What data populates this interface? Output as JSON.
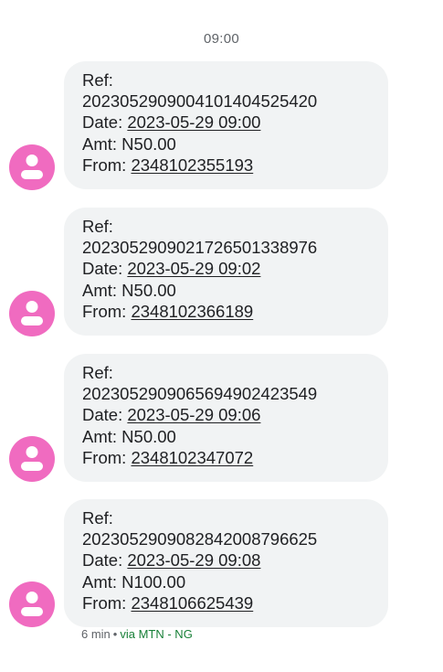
{
  "conversation": {
    "timestamp": "09:00",
    "messages": [
      {
        "ref_label": "Ref:",
        "ref": "20230529090041014045254 20",
        "date_label": "Date:",
        "date": "2023-05-29 09:00",
        "amt_label": "Amt:",
        "amt": "N50.00",
        "from_label": "From:",
        "from": "2348102355193"
      },
      {
        "ref_label": "Ref:",
        "ref": "20230529090217265013389 76",
        "date_label": "Date:",
        "date": "2023-05-29 09:02",
        "amt_label": "Amt:",
        "amt": "N50.00",
        "from_label": "From:",
        "from": "2348102366189"
      },
      {
        "ref_label": "Ref:",
        "ref": "20230529090656949024235 49",
        "date_label": "Date:",
        "date": "2023-05-29 09:06",
        "amt_label": "Amt:",
        "amt": "N50.00",
        "from_label": "From:",
        "from": "2348102347072"
      },
      {
        "ref_label": "Ref:",
        "ref": "20230529090828420087966 25",
        "date_label": "Date:",
        "date": "2023-05-29 09:08",
        "amt_label": "Amt:",
        "amt": "N100.00",
        "from_label": "From:",
        "from": "2348106625439"
      }
    ],
    "meta": {
      "time_ago": "6 min",
      "separator": "•",
      "via": "via MTN - NG"
    }
  },
  "colors": {
    "avatar": "#f06bc0",
    "bubble": "#f1f3f4",
    "sim_label": "#188038"
  }
}
